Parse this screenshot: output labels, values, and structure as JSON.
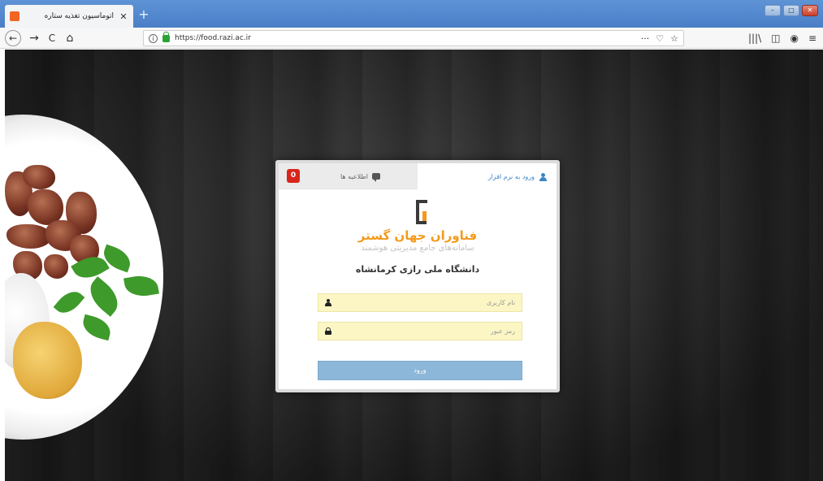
{
  "browser": {
    "tab": {
      "title": "اتوماسیون تغذیه ستاره",
      "close_glyph": "✕",
      "favicon": "orange-square-icon"
    },
    "new_tab_glyph": "+",
    "window_controls": [
      "–",
      "□",
      "✕"
    ],
    "nav": {
      "back": "←",
      "forward": "→",
      "reload": "C",
      "home": "⌂"
    },
    "address": {
      "info_glyph": "i",
      "url": "https://food.razi.ac.ir",
      "more": "···",
      "pocket": "♡",
      "bookmark": "☆"
    },
    "tools": {
      "library": "|||\\",
      "sidebar": "◫",
      "account": "◉",
      "menu": "≡"
    }
  },
  "login_card": {
    "tabs": {
      "login_label": "ورود به نرم افزار",
      "news_label": "اطلاعیه ها",
      "news_count": "0"
    },
    "brand": {
      "name": "فناوران جهان گستر",
      "tagline": "سامانه‌های جامع مدیریتی هوشمند"
    },
    "university": "دانشگاه ملی رازی کرمانشاه",
    "username": {
      "placeholder": "نام کاربری",
      "value": ""
    },
    "password": {
      "placeholder": "رمز عبور",
      "value": ""
    },
    "submit_label": "ورود"
  },
  "colors": {
    "accent": "#3d84c6",
    "brand_orange": "#f29a1c",
    "badge_red": "#d8261c",
    "field_bg": "#fbf6c4",
    "button_bg": "#8db7d8"
  }
}
